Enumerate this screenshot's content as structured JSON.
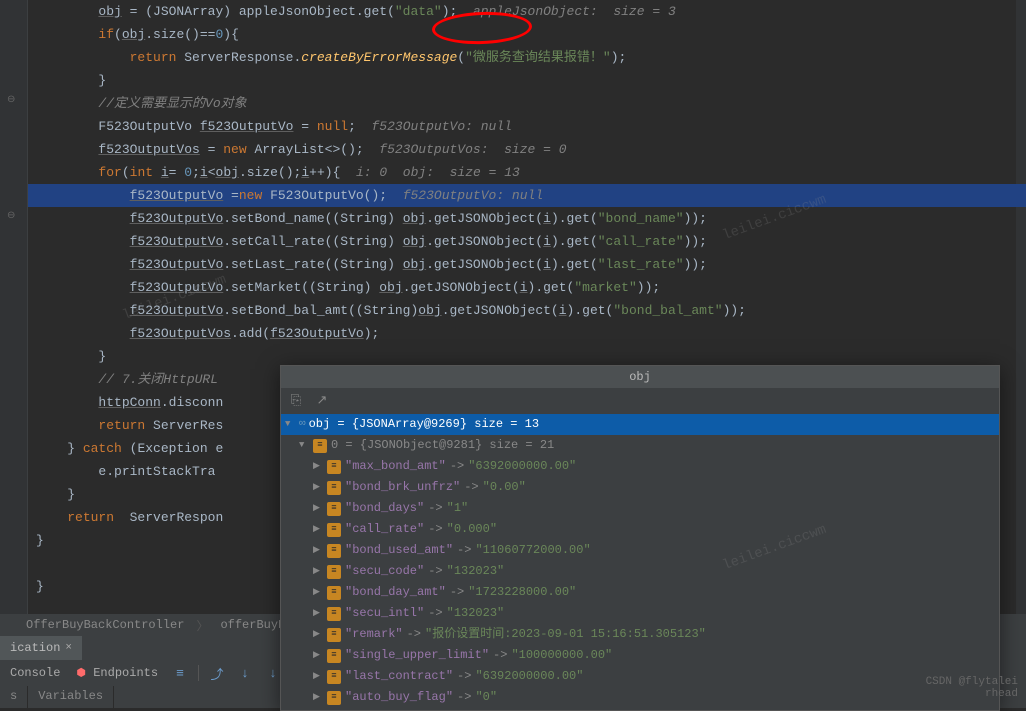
{
  "code": {
    "l1a": "obj",
    "l1b": " = (JSONArray) appleJsonObject.get(",
    "l1c": "\"data\"",
    "l1d": ");  ",
    "l1e": "appleJsonObject:  size = 3",
    "l2a": "if",
    "l2b": "(",
    "l2c": "obj",
    "l2d": ".size()==",
    "l2e": "0",
    "l2f": "){",
    "l3a": "return",
    "l3b": " ServerResponse.",
    "l3c": "createByErrorMessage",
    "l3d": "(",
    "l3e": "\"微服务查询结果报错！\"",
    "l3f": ");",
    "l4": "}",
    "l5": "//定义需要显示的Vo对象",
    "l6a": "F523OutputVo ",
    "l6b": "f523OutputVo",
    "l6c": " = ",
    "l6d": "null",
    "l6e": ";  ",
    "l6f": "f523OutputVo: null",
    "l7a": "f523OutputVos",
    "l7b": " = ",
    "l7c": "new",
    "l7d": " ArrayList<>();  ",
    "l7e": "f523OutputVos:  size = 0",
    "l8a": "for",
    "l8b": "(",
    "l8c": "int",
    "l8d": " ",
    "l8e": "i",
    "l8f": "= ",
    "l8g": "0",
    "l8h": ";",
    "l8i": "i",
    "l8j": "<",
    "l8k": "obj",
    "l8l": ".size();",
    "l8m": "i",
    "l8n": "++){  ",
    "l8o": "i: 0  obj:  size = 13",
    "l9a": "f523OutputVo",
    "l9b": " =",
    "l9c": "new",
    "l9d": " F523OutputVo();  ",
    "l9e": "f523OutputVo: null",
    "l10a": "f523OutputVo",
    "l10b": ".setBond_name((String) ",
    "l10c": "obj",
    "l10d": ".getJSONObject(",
    "l10e": "i",
    "l10f": ").get(",
    "l10g": "\"bond_name\"",
    "l10h": "));",
    "l11a": "f523OutputVo",
    "l11b": ".setCall_rate((String) ",
    "l11c": "obj",
    "l11d": ".getJSONObject(",
    "l11e": "i",
    "l11f": ").get(",
    "l11g": "\"call_rate\"",
    "l11h": "));",
    "l12a": "f523OutputVo",
    "l12b": ".setLast_rate((String) ",
    "l12c": "obj",
    "l12d": ".getJSONObject(",
    "l12e": "i",
    "l12f": ").get(",
    "l12g": "\"last_rate\"",
    "l12h": "));",
    "l13a": "f523OutputVo",
    "l13b": ".setMarket((String) ",
    "l13c": "obj",
    "l13d": ".getJSONObject(",
    "l13e": "i",
    "l13f": ").get(",
    "l13g": "\"market\"",
    "l13h": "));",
    "l14a": "f523OutputVo",
    "l14b": ".setBond_bal_amt((String)",
    "l14c": "obj",
    "l14d": ".getJSONObject(",
    "l14e": "i",
    "l14f": ").get(",
    "l14g": "\"bond_bal_amt\"",
    "l14h": "));",
    "l15a": "f523OutputVos",
    "l15b": ".add(",
    "l15c": "f523OutputVo",
    "l15d": ");",
    "l16": "}",
    "l17": "// 7.关闭HttpURL",
    "l18a": "httpConn",
    "l18b": ".disconn",
    "l19a": "return",
    "l19b": " ServerRes",
    "l20a": "} ",
    "l20b": "catch",
    "l20c": " (Exception e",
    "l21": "e.printStackTra",
    "l22": "}",
    "l23a": "return",
    "l23b": "  ServerRespon",
    "l24": "}",
    "l25": "}"
  },
  "breadcrumb": {
    "a": "OfferBuyBackController",
    "b": "offerBuyBack()"
  },
  "tab": {
    "name": "ication",
    "close": "×"
  },
  "toolbar": {
    "console": "Console",
    "endpoints": "Endpoints"
  },
  "subtabs": {
    "a": "s",
    "b": "Variables"
  },
  "popup": {
    "title": "obj",
    "root": "obj = {JSONArray@9269}  size = 13",
    "node0": "0 = {JSONObject@9281}  size = 21",
    "rows": [
      {
        "k": "\"max_bond_amt\"",
        "v": "\"6392000000.00\""
      },
      {
        "k": "\"bond_brk_unfrz\"",
        "v": "\"0.00\""
      },
      {
        "k": "\"bond_days\"",
        "v": "\"1\""
      },
      {
        "k": "\"call_rate\"",
        "v": "\"0.000\""
      },
      {
        "k": "\"bond_used_amt\"",
        "v": "\"11060772000.00\""
      },
      {
        "k": "\"secu_code\"",
        "v": "\"132023\""
      },
      {
        "k": "\"bond_day_amt\"",
        "v": "\"1723228000.00\""
      },
      {
        "k": "\"secu_intl\"",
        "v": "\"132023\""
      },
      {
        "k": "\"remark\"",
        "v": "\"报价设置时间:2023-09-01 15:16:51.305123\""
      },
      {
        "k": "\"single_upper_limit\"",
        "v": "\"100000000.00\""
      },
      {
        "k": "\"last_contract\"",
        "v": "\"6392000000.00\""
      },
      {
        "k": "\"auto_buy_flag\"",
        "v": "\"0\""
      }
    ]
  },
  "watermark": "leilei.ciccwm",
  "csdn": "CSDN @flytalei",
  "csdn2": "rhead"
}
